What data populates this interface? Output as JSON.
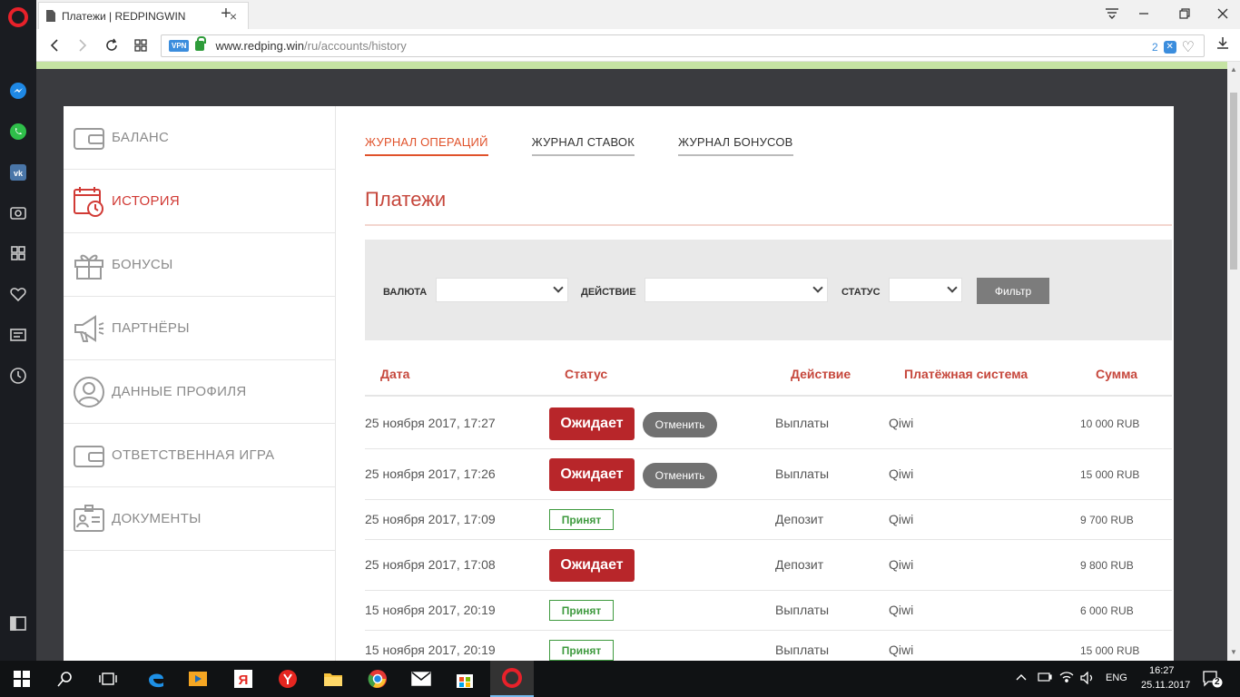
{
  "browser": {
    "tab_title": "Платежи | REDPINGWIN",
    "tab_close": "×",
    "new_tab": "+",
    "vpn_badge": "VPN",
    "url_host": "www.redping.win",
    "url_path": "/ru/accounts/history",
    "adblock_count": "2"
  },
  "sidebar": {
    "items": [
      {
        "label": "БАЛАНС",
        "icon": "wallet-icon"
      },
      {
        "label": "ИСТОРИЯ",
        "icon": "calendar-clock-icon"
      },
      {
        "label": "БОНУСЫ",
        "icon": "gift-icon"
      },
      {
        "label": "ПАРТНЁРЫ",
        "icon": "megaphone-icon"
      },
      {
        "label": "ДАННЫЕ ПРОФИЛЯ",
        "icon": "user-icon"
      },
      {
        "label": "ОТВЕТСТВЕННАЯ ИГРА",
        "icon": "wallet-icon"
      },
      {
        "label": "ДОКУМЕНТЫ",
        "icon": "id-card-icon"
      }
    ],
    "active": "ИСТОРИЯ"
  },
  "tabs": [
    "ЖУРНАЛ ОПЕРАЦИЙ",
    "ЖУРНАЛ СТАВОК",
    "ЖУРНАЛ БОНУСОВ"
  ],
  "heading": "Платежи",
  "filter": {
    "currency_label": "ВАЛЮТА",
    "action_label": "ДЕЙСТВИЕ",
    "status_label": "СТАТУС",
    "button": "Фильтр"
  },
  "table": {
    "headers": [
      "Дата",
      "Статус",
      "Действие",
      "Платёжная система",
      "Сумма"
    ],
    "cancel_label": "Отменить",
    "rows": [
      {
        "date": "25 ноября 2017, 17:27",
        "status": "Ожидает",
        "cancel": true,
        "action": "Выплаты",
        "system": "Qiwi",
        "amount": "10 000 RUB"
      },
      {
        "date": "25 ноября 2017, 17:26",
        "status": "Ожидает",
        "cancel": true,
        "action": "Выплаты",
        "system": "Qiwi",
        "amount": "15 000 RUB"
      },
      {
        "date": "25 ноября 2017, 17:09",
        "status": "Принят",
        "cancel": false,
        "action": "Депозит",
        "system": "Qiwi",
        "amount": "9 700 RUB"
      },
      {
        "date": "25 ноября 2017, 17:08",
        "status": "Ожидает",
        "cancel": false,
        "action": "Депозит",
        "system": "Qiwi",
        "amount": "9 800 RUB"
      },
      {
        "date": "15 ноября 2017, 20:19",
        "status": "Принят",
        "cancel": false,
        "action": "Выплаты",
        "system": "Qiwi",
        "amount": "6 000 RUB"
      },
      {
        "date": "15 ноября 2017, 20:19",
        "status": "Принят",
        "cancel": false,
        "action": "Выплаты",
        "system": "Qiwi",
        "amount": "15 000 RUB"
      }
    ]
  },
  "taskbar": {
    "lang": "ENG",
    "time": "16:27",
    "date": "25.11.2017",
    "notifications": "2"
  },
  "colors": {
    "accent": "#c6473c",
    "pending": "#b8262a",
    "accepted": "#3e9a3e",
    "tab_active": "#e0522b"
  }
}
